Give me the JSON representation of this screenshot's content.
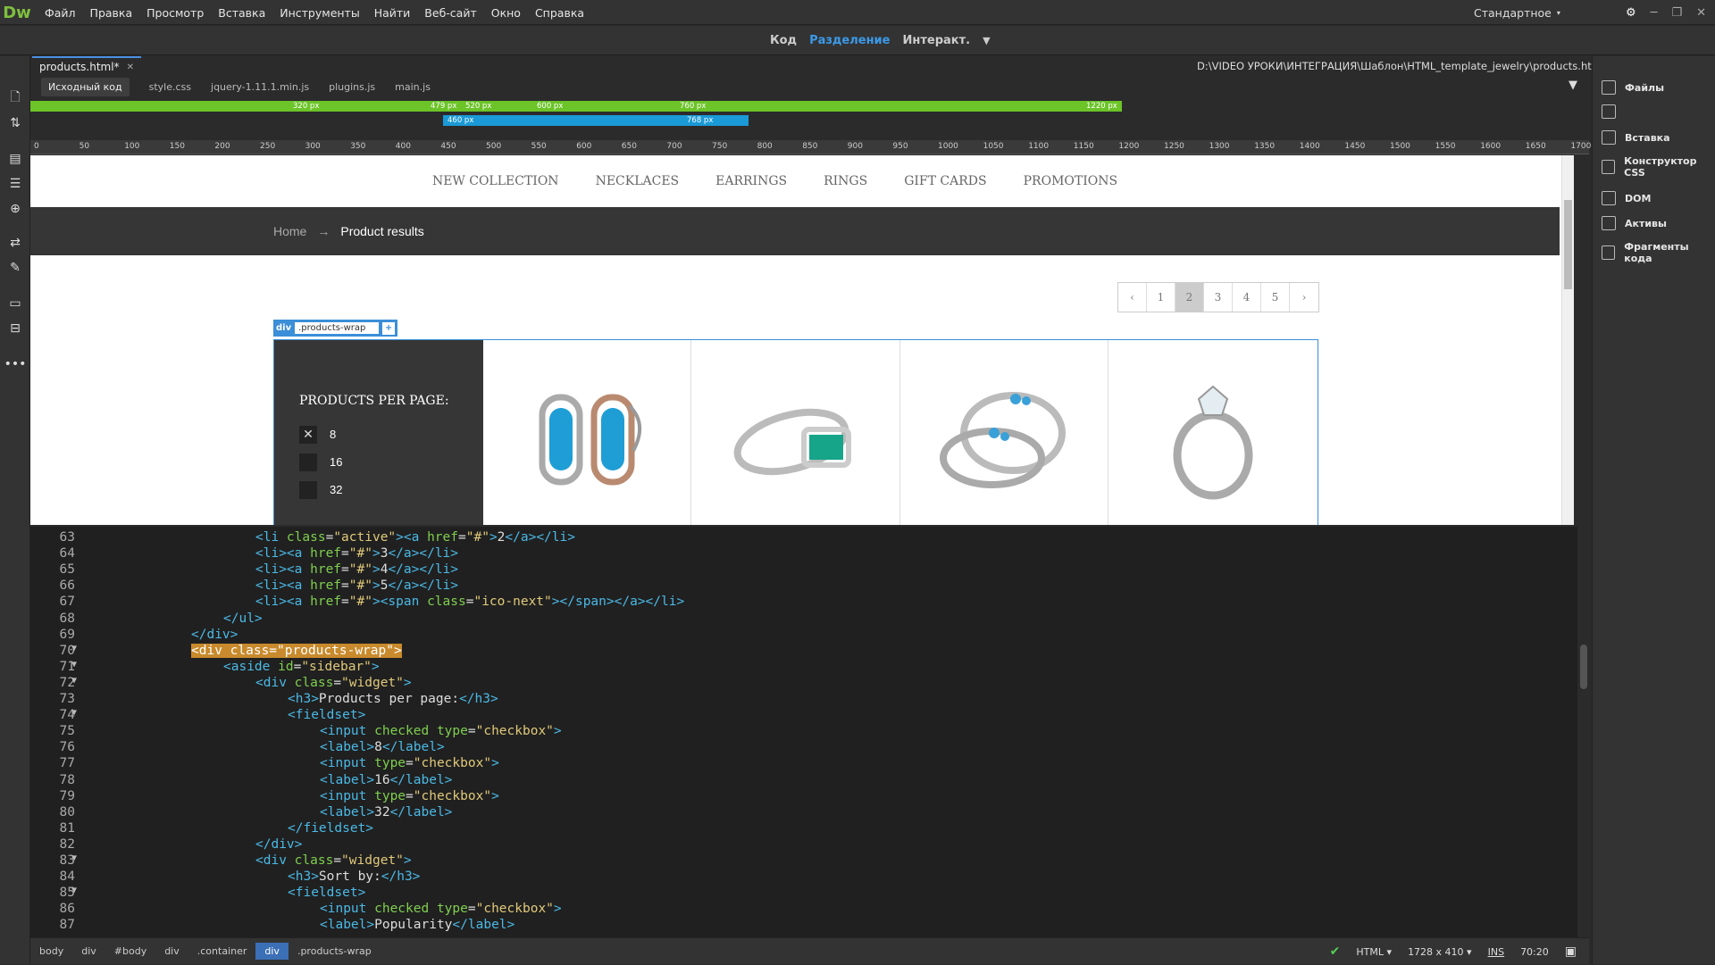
{
  "app": {
    "logo": "Dw",
    "menu": [
      "Файл",
      "Правка",
      "Просмотр",
      "Вставка",
      "Инструменты",
      "Найти",
      "Веб-сайт",
      "Окно",
      "Справка"
    ],
    "workspace": "Стандартное"
  },
  "views": {
    "code": "Код",
    "split": "Разделение",
    "live": "Интеракт.",
    "active": "Разделение"
  },
  "document": {
    "tab": "products.html*",
    "path": "D:\\VIDEO УРОКИ\\ИНТЕГРАЦИЯ\\Шаблон\\HTML_template_jewelry\\products.html",
    "related": [
      "Исходный код",
      "style.css",
      "jquery-1.11.1.min.js",
      "plugins.js",
      "main.js"
    ]
  },
  "media_queries": {
    "green": [
      "320 px",
      "479 px",
      "520 px",
      "600 px",
      "760 px",
      "1220 px"
    ],
    "blue": [
      "460 px",
      "768 px"
    ]
  },
  "ruler": [
    "0",
    "50",
    "100",
    "150",
    "200",
    "250",
    "300",
    "350",
    "400",
    "450",
    "500",
    "550",
    "600",
    "650",
    "700",
    "750",
    "800",
    "850",
    "900",
    "950",
    "1000",
    "1050",
    "1100",
    "1150",
    "1200",
    "1250",
    "1300",
    "1350",
    "1400",
    "1450",
    "1500",
    "1550",
    "1600",
    "1650",
    "1700"
  ],
  "right_panel": [
    "Файлы",
    "",
    "Вставка",
    "Конструктор CSS",
    "DOM",
    "Активы",
    "Фрагменты кода"
  ],
  "page": {
    "nav": [
      "NEW COLLECTION",
      "NECKLACES",
      "EARRINGS",
      "RINGS",
      "GIFT CARDS",
      "PROMOTIONS"
    ],
    "breadcrumb": {
      "home": "Home",
      "arrow": "→",
      "current": "Product results"
    },
    "pager": [
      "‹",
      "1",
      "2",
      "3",
      "4",
      "5",
      "›"
    ],
    "pager_active": "2",
    "selection": {
      "tag": "div",
      "class": ".products-wrap",
      "plus": "+"
    },
    "sidebar": {
      "title": "PRODUCTS PER PAGE:",
      "options": [
        {
          "label": "8",
          "checked": true
        },
        {
          "label": "16",
          "checked": false
        },
        {
          "label": "32",
          "checked": false
        }
      ]
    }
  },
  "code": {
    "lines": [
      "63",
      "64",
      "65",
      "66",
      "67",
      "68",
      "69",
      "70",
      "71",
      "72",
      "73",
      "74",
      "75",
      "76",
      "77",
      "78",
      "79",
      "80",
      "81",
      "82",
      "83",
      "84",
      "85",
      "86",
      "87"
    ]
  },
  "status": {
    "tags": [
      "body",
      "div",
      "#body",
      "div",
      ".container",
      "div",
      ".products-wrap"
    ],
    "language": "HTML",
    "size": "1728 x 410",
    "mode": "INS",
    "position": "70:20"
  }
}
